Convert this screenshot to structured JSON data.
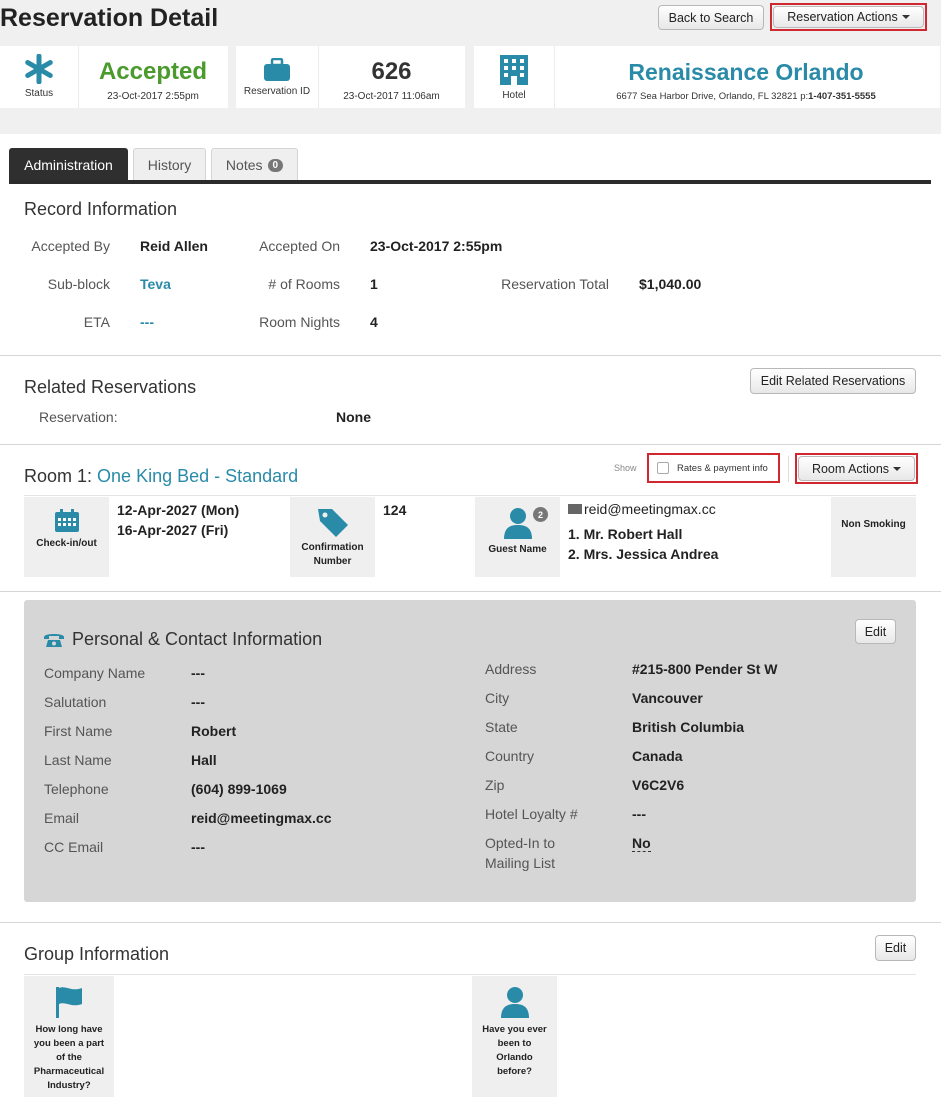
{
  "header": {
    "title": "Reservation Detail",
    "back_button": "Back to Search",
    "actions_button": "Reservation Actions"
  },
  "summary": {
    "status_label": "Status",
    "status_value": "Accepted",
    "status_date": "23-Oct-2017 2:55pm",
    "reservation_id_label": "Reservation ID",
    "reservation_id": "626",
    "reservation_date": "23-Oct-2017 11:06am",
    "hotel_label": "Hotel",
    "hotel_name": "Renaissance Orlando",
    "hotel_address": "6677 Sea Harbor Drive, Orlando, FL 32821",
    "hotel_phone_prefix": "p:",
    "hotel_phone": "1-407-351-5555"
  },
  "tabs": [
    {
      "label": "Administration"
    },
    {
      "label": "History"
    },
    {
      "label": "Notes",
      "count": "0"
    }
  ],
  "record": {
    "title": "Record Information",
    "accepted_by_label": "Accepted By",
    "accepted_by": "Reid Allen",
    "accepted_on_label": "Accepted On",
    "accepted_on": "23-Oct-2017 2:55pm",
    "subblock_label": "Sub-block",
    "subblock": "Teva",
    "rooms_label": "# of Rooms",
    "rooms": "1",
    "total_label": "Reservation Total",
    "total": "$1,040.00",
    "eta_label": "ETA",
    "eta": "---",
    "nights_label": "Room Nights",
    "nights": "4"
  },
  "related": {
    "title": "Related Reservations",
    "edit_button": "Edit Related Reservations",
    "reservation_label": "Reservation:",
    "reservation_value": "None"
  },
  "room": {
    "prefix": "Room 1:",
    "type": "One King Bed - Standard",
    "show_label": "Show",
    "rates_label": "Rates & payment info",
    "actions_button": "Room Actions",
    "checkin_label": "Check-in/out",
    "checkin": "12-Apr-2027 (Mon)",
    "checkout": "16-Apr-2027 (Fri)",
    "confirmation_label": "Confirmation Number",
    "confirmation": "124",
    "guest_label": "Guest Name",
    "guest_count": "2",
    "guest_email": "reid@meetingmax.cc",
    "guest_1": "1. Mr. Robert Hall",
    "guest_2": "2. Mrs. Jessica Andrea",
    "smoking": "Non Smoking"
  },
  "contact": {
    "title": "Personal & Contact Information",
    "edit_button": "Edit",
    "left": [
      {
        "label": "Company Name",
        "value": "---"
      },
      {
        "label": "Salutation",
        "value": "---"
      },
      {
        "label": "First Name",
        "value": "Robert"
      },
      {
        "label": "Last Name",
        "value": "Hall"
      },
      {
        "label": "Telephone",
        "value": "(604) 899-1069"
      },
      {
        "label": "Email",
        "value": "reid@meetingmax.cc"
      },
      {
        "label": "CC Email",
        "value": "---"
      }
    ],
    "right": [
      {
        "label": "Address",
        "value": "#215-800 Pender St W"
      },
      {
        "label": "City",
        "value": "Vancouver"
      },
      {
        "label": "State",
        "value": "British Columbia"
      },
      {
        "label": "Country",
        "value": "Canada"
      },
      {
        "label": "Zip",
        "value": "V6C2V6"
      },
      {
        "label": "Hotel Loyalty #",
        "value": "---"
      }
    ],
    "optin_label_1": "Opted-In to",
    "optin_label_2": "Mailing List",
    "optin_value": "No"
  },
  "group": {
    "title": "Group Information",
    "edit_button": "Edit",
    "q1_lines": [
      "How long have",
      "you been a part",
      "of the",
      "Pharmaceutical",
      "Industry?"
    ],
    "q2_lines": [
      "Have you ever",
      "been to",
      "Orlando",
      "before?"
    ]
  },
  "colors": {
    "accent": "#2a8ba9",
    "status_green": "#4a9a2c",
    "highlight_red": "#d0282e",
    "tab_dark": "#2f2f2f"
  }
}
